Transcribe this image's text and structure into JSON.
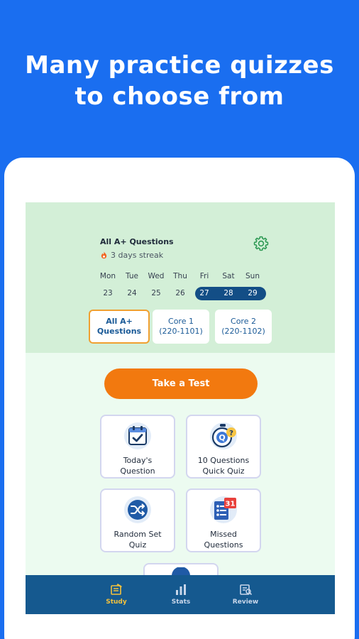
{
  "headline": {
    "line1": "Many practice quizzes",
    "line2": "to choose from"
  },
  "quiz": {
    "title": "All A+ Questions",
    "streak": "3 days streak"
  },
  "week": {
    "days": [
      {
        "name": "Mon",
        "num": "23",
        "highlight": false
      },
      {
        "name": "Tue",
        "num": "24",
        "highlight": false
      },
      {
        "name": "Wed",
        "num": "25",
        "highlight": false
      },
      {
        "name": "Thu",
        "num": "26",
        "highlight": false
      },
      {
        "name": "Fri",
        "num": "27",
        "highlight": true
      },
      {
        "name": "Sat",
        "num": "28",
        "highlight": true
      },
      {
        "name": "Sun",
        "num": "29",
        "highlight": true
      }
    ]
  },
  "tabs": [
    {
      "line1": "All A+",
      "line2": "Questions",
      "active": true
    },
    {
      "line1": "Core 1",
      "line2": "(220-1101)",
      "active": false
    },
    {
      "line1": "Core 2",
      "line2": "(220-1102)",
      "active": false
    }
  ],
  "take_test_label": "Take a Test",
  "cards": [
    {
      "line1": "Today's",
      "line2": "Question",
      "icon": "calendar-check-icon"
    },
    {
      "line1": "10 Questions",
      "line2": "Quick Quiz",
      "icon": "stopwatch-question-icon"
    },
    {
      "line1": "Random Set",
      "line2": "Quiz",
      "icon": "shuffle-icon"
    },
    {
      "line1": "Missed",
      "line2": "Questions",
      "icon": "missed-list-icon",
      "badge": "31"
    }
  ],
  "nav": [
    {
      "label": "Study",
      "icon": "study-icon",
      "active": true
    },
    {
      "label": "Stats",
      "icon": "stats-icon",
      "active": false
    },
    {
      "label": "Review",
      "icon": "review-icon",
      "active": false
    }
  ],
  "colors": {
    "background": "#1a6ef0",
    "navy": "#134e86",
    "orange": "#f2790f",
    "active_nav": "#f4c23d"
  }
}
